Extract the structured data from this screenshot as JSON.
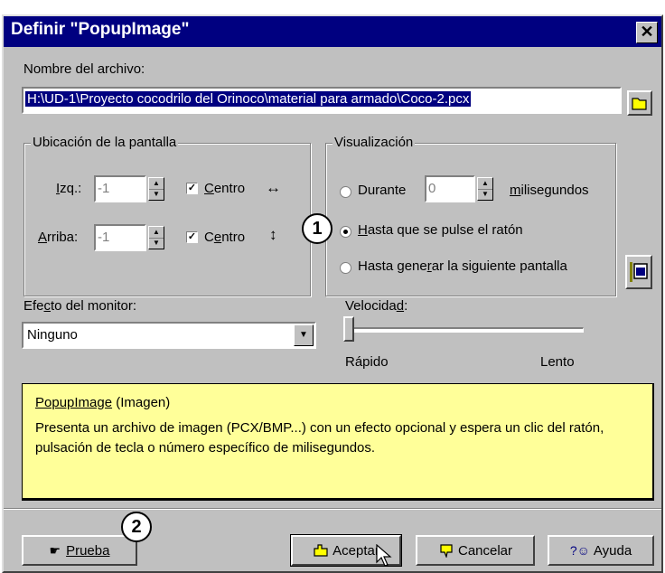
{
  "window": {
    "title": "Definir \"PopupImage\"",
    "close_label": "✕"
  },
  "file": {
    "label": "Nombre del archivo:",
    "value": "H:\\UD-1\\Proyecto cocodrilo del Orinoco\\material para armado\\Coco-2.pcx"
  },
  "location": {
    "title": "Ubicación de la pantalla",
    "left_label": "Izq.:",
    "left_value": "-1",
    "top_label": "Arriba:",
    "top_value": "-1",
    "center_label": "Centro",
    "horiz_arrow": "↔",
    "vert_arrow": "↕",
    "check_mark": "✓"
  },
  "display": {
    "title": "Visualización",
    "during_label": "Durante",
    "during_value": "0",
    "ms_label": "milisegundos",
    "until_click_label": "Hasta que se pulse el ratón",
    "until_next_label": "Hasta generar la siguiente pantalla"
  },
  "effect": {
    "label": "Efecto del monitor:",
    "value": "Ninguno",
    "dropdown_arrow": "▼"
  },
  "speed": {
    "label": "Velocidad:",
    "fast": "Rápido",
    "slow": "Lento",
    "level": 0
  },
  "info": {
    "title": "PopupImage",
    "subtitle": "(Imagen)",
    "description": "Presenta un archivo de imagen (PCX/BMP...) con un efecto opcional y espera un clic del ratón, pulsación de tecla o número específico de milisegundos."
  },
  "buttons": {
    "test": "Prueba",
    "ok": "Aceptar",
    "cancel": "Cancelar",
    "help": "Ayuda"
  },
  "callouts": {
    "one": "1",
    "two": "2"
  },
  "colors": {
    "title_bar": "#000080",
    "info_bg": "#ffff99",
    "selection": "#000080"
  }
}
